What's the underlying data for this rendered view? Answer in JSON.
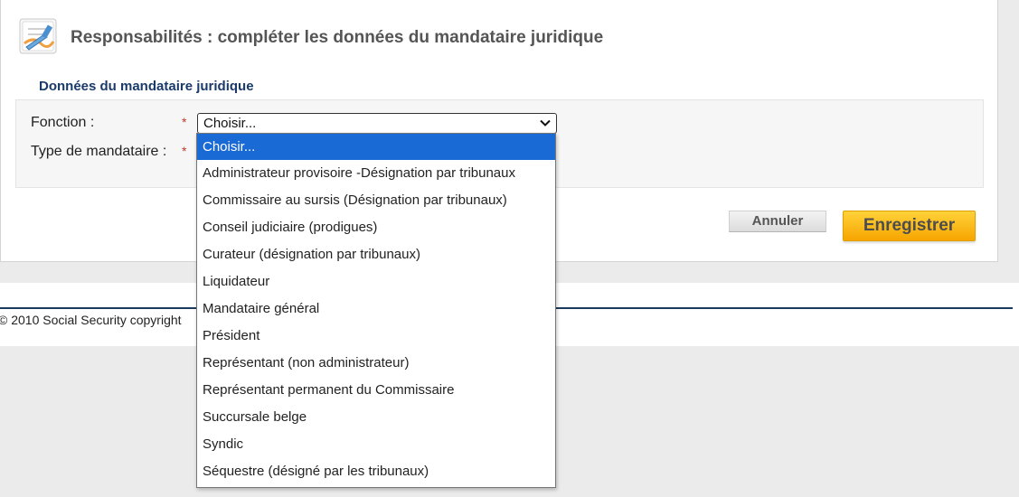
{
  "header": {
    "icon": "document-pen-icon",
    "title": "Responsabilités : compléter les données du mandataire juridique"
  },
  "section": {
    "title": "Données du mandataire juridique"
  },
  "form": {
    "fonction_label": "Fonction :",
    "type_label": "Type de mandataire :",
    "required_mark": "*",
    "fonction_value": "Choisir..."
  },
  "dropdown": {
    "options": [
      "Choisir...",
      "Administrateur provisoire -Désignation par tribunaux",
      "Commissaire au sursis (Désignation par tribunaux)",
      "Conseil judiciaire (prodigues)",
      "Curateur (désignation par tribunaux)",
      "Liquidateur",
      "Mandataire général",
      "Président",
      "Représentant (non administrateur)",
      "Représentant permanent du Commissaire",
      "Succursale belge",
      "Syndic",
      "Séquestre (désigné par les tribunaux)"
    ],
    "selected_index": 0
  },
  "buttons": {
    "cancel_label": "Annuler",
    "save_label": "Enregistrer"
  },
  "footer": {
    "copyright": "© 2010 Social Security copyright"
  },
  "colors": {
    "accent_blue": "#1a6ad6",
    "section_title": "#1a3a6a",
    "save_button": "#f7a500",
    "required": "#c0392b"
  }
}
